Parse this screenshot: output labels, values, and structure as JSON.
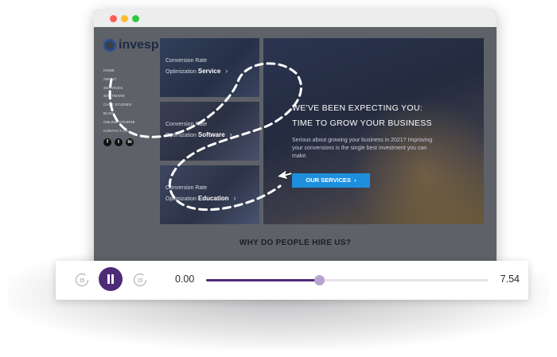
{
  "site": {
    "logo_text": "invesp",
    "nav": [
      "HOME",
      "ABOUT",
      "SERVICES",
      "SOFTWARE",
      "CASE STUDIES",
      "BLOG",
      "ONLINE COURSE",
      "CONTACT US"
    ],
    "socials": [
      {
        "icon": "facebook-icon",
        "glyph": "f"
      },
      {
        "icon": "twitter-icon",
        "glyph": "t"
      },
      {
        "icon": "linkedin-icon",
        "glyph": "in"
      }
    ],
    "cards": [
      {
        "line1": "Conversion Rate",
        "line2": "Optimization",
        "bold": "Service"
      },
      {
        "line1": "Conversion Rate",
        "line2": "Optimization",
        "bold": "Software"
      },
      {
        "line1": "Conversion Rate",
        "line2": "Optimization",
        "bold": "Education"
      }
    ],
    "hero": {
      "heading_line1": "WE'VE BEEN EXPECTING YOU:",
      "heading_line2": "TIME TO GROW YOUR BUSINESS",
      "paragraph": "Serious about growing your business in 2021? Improving your conversions is the single best investment you can make.",
      "button_label": "OUR SERVICES"
    },
    "section_title": "WHY DO PEOPLE HIRE US?"
  },
  "player": {
    "skip_back_seconds": "15",
    "skip_forward_seconds": "15",
    "current_time": "0.00",
    "duration": "7.54",
    "progress": 0.4,
    "colors": {
      "accent": "#4e2b77",
      "knob": "#b7a3cf"
    }
  },
  "colors": {
    "button": "#1e8fdc",
    "logo": "#1c2a44"
  }
}
